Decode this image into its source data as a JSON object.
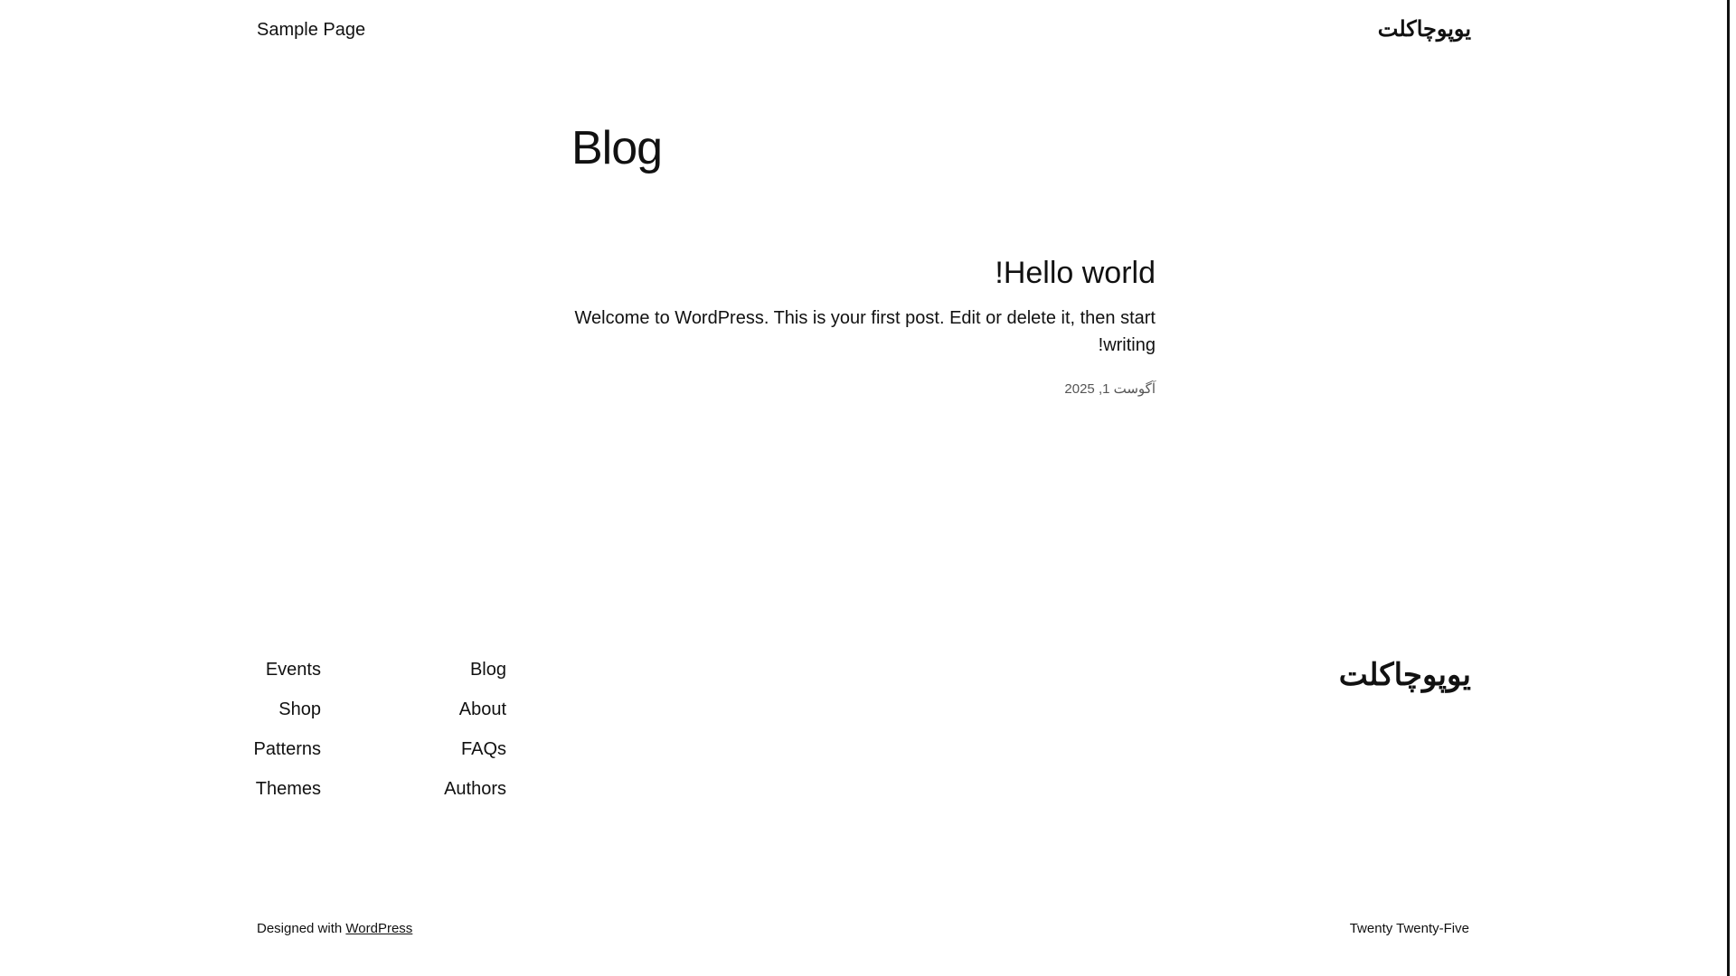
{
  "header": {
    "nav_item": "Sample Page",
    "site_title": "یوپوچاکلت"
  },
  "main": {
    "page_title": "Blog",
    "post": {
      "title": "Hello world!",
      "excerpt": "Welcome to WordPress. This is your first post. Edit or delete it, then start writing!",
      "date": "آگوست 1, 2025"
    }
  },
  "footer": {
    "site_title": "یوپوچاکلت",
    "nav_col_1": [
      "Blog",
      "About",
      "FAQs",
      "Authors"
    ],
    "nav_col_2": [
      "Events",
      "Shop",
      "Patterns",
      "Themes"
    ],
    "credit_prefix": "Designed with",
    "credit_link": "WordPress",
    "theme_name": "Twenty Twenty-Five"
  }
}
